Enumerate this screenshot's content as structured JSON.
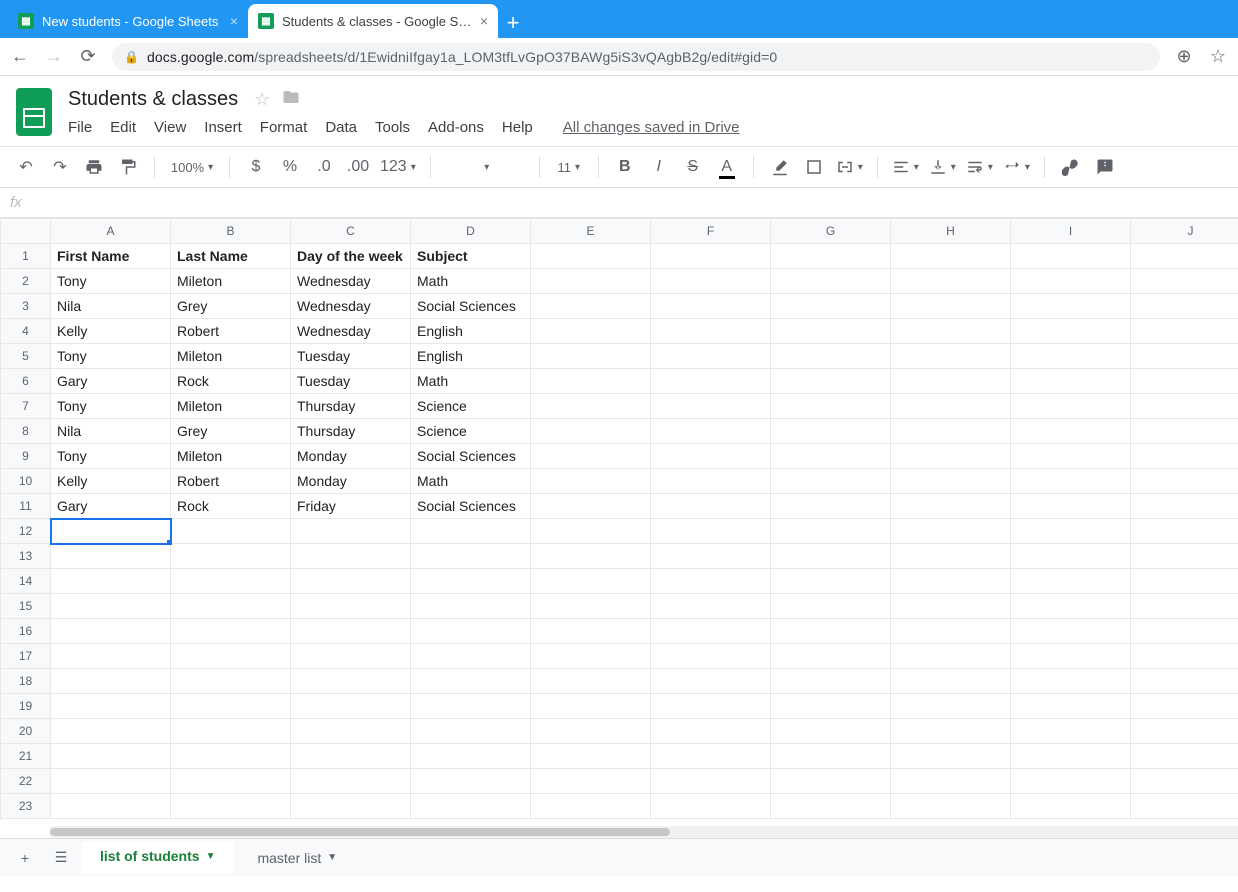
{
  "browser": {
    "tabs": [
      {
        "title": "New students - Google Sheets",
        "active": false
      },
      {
        "title": "Students & classes - Google She…",
        "active": true
      }
    ],
    "url_host": "docs.google.com",
    "url_path": "/spreadsheets/d/1EwidniIfgay1a_LOM3tfLvGpO37BAWg5iS3vQAgbB2g/edit#gid=0"
  },
  "doc": {
    "title": "Students & classes",
    "menus": [
      "File",
      "Edit",
      "View",
      "Insert",
      "Format",
      "Data",
      "Tools",
      "Add-ons",
      "Help"
    ],
    "save_status": "All changes saved in Drive"
  },
  "toolbar": {
    "zoom": "100%",
    "font_size": "11",
    "format_code": "123"
  },
  "sheet": {
    "columns": [
      "A",
      "B",
      "C",
      "D",
      "E",
      "F",
      "G",
      "H",
      "I",
      "J"
    ],
    "row_count": 23,
    "headers": [
      "First Name",
      "Last Name",
      "Day of the week",
      "Subject"
    ],
    "rows": [
      [
        "Tony",
        "Mileton",
        "Wednesday",
        "Math"
      ],
      [
        "Nila",
        "Grey",
        "Wednesday",
        "Social Sciences"
      ],
      [
        "Kelly",
        "Robert",
        "Wednesday",
        "English"
      ],
      [
        "Tony",
        "Mileton",
        "Tuesday",
        "English"
      ],
      [
        "Gary",
        "Rock",
        "Tuesday",
        "Math"
      ],
      [
        "Tony",
        "Mileton",
        "Thursday",
        "Science"
      ],
      [
        "Nila",
        "Grey",
        "Thursday",
        "Science"
      ],
      [
        "Tony",
        "Mileton",
        "Monday",
        "Social Sciences"
      ],
      [
        "Kelly",
        "Robert",
        "Monday",
        "Math"
      ],
      [
        "Gary",
        "Rock",
        "Friday",
        "Social Sciences"
      ]
    ],
    "selected_cell": {
      "row": 12,
      "col": 0
    }
  },
  "sheet_tabs": {
    "add_label": "+",
    "tabs": [
      {
        "name": "list of students",
        "active": true
      },
      {
        "name": "master list",
        "active": false
      }
    ]
  }
}
